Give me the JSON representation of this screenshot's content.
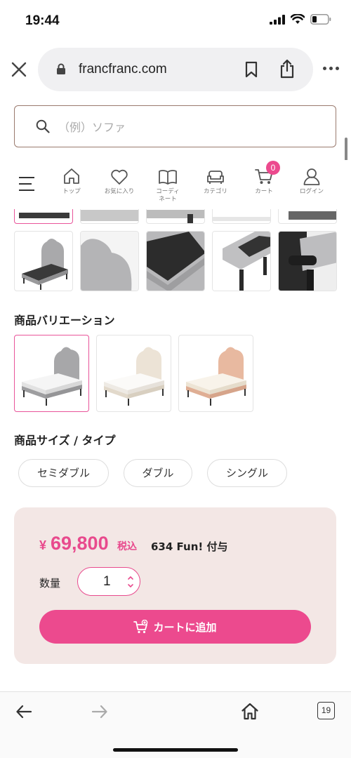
{
  "status_bar": {
    "time": "19:44"
  },
  "browser": {
    "url": "francfranc.com",
    "tab_count": "19"
  },
  "search": {
    "placeholder": "（例）ソファ"
  },
  "nav": {
    "items": [
      {
        "label": "トップ",
        "icon": "home-icon"
      },
      {
        "label": "お気に入り",
        "icon": "heart-icon"
      },
      {
        "label": "コーディ\nネート",
        "icon": "book-icon"
      },
      {
        "label": "カテゴリ",
        "icon": "sofa-icon"
      },
      {
        "label": "カート",
        "icon": "cart-icon",
        "badge": "0"
      },
      {
        "label": "ログイン",
        "icon": "user-icon"
      }
    ]
  },
  "variations": {
    "title": "商品バリエーション",
    "colors": [
      "#a7a7a9",
      "#ece3d6",
      "#e8b9a0"
    ]
  },
  "sizes": {
    "title": "商品サイズ / タイプ",
    "options": [
      "セミダブル",
      "ダブル",
      "シングル"
    ]
  },
  "purchase": {
    "currency": "¥",
    "price": "69,800",
    "tax_label": "税込",
    "points": "634 Fun! 付与",
    "qty_label": "数量",
    "qty_value": "1",
    "add_to_cart": "カートに追加"
  },
  "colors": {
    "accent": "#ec4a8e",
    "panel": "#f3e7e5"
  }
}
